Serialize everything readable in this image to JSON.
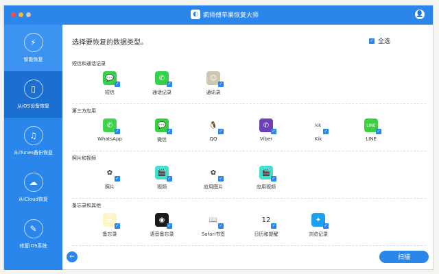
{
  "window": {
    "title": "疯师傅苹果恢复大师"
  },
  "sidebar": {
    "items": [
      {
        "label": "智能恢复",
        "icon": "smart-recovery-icon",
        "glyph": "⚡"
      },
      {
        "label": "从iOS设备恢复",
        "icon": "phone-icon",
        "glyph": "▯"
      },
      {
        "label": "从iTunes备份恢复",
        "icon": "music-icon",
        "glyph": "♫"
      },
      {
        "label": "从iCloud恢复",
        "icon": "cloud-icon",
        "glyph": "☁"
      },
      {
        "label": "修复iOS系统",
        "icon": "wrench-icon",
        "glyph": "✎"
      }
    ]
  },
  "main": {
    "heading": "选择要恢复的数据类型。",
    "select_all": "全选",
    "sections": [
      {
        "label": "短信和通话记录",
        "items": [
          {
            "label": "短信",
            "icon": "messages-icon",
            "color": "#35d14a",
            "glyph": "💬"
          },
          {
            "label": "通话记录",
            "icon": "phone-call-icon",
            "color": "#35d14a",
            "glyph": "✆"
          },
          {
            "label": "通讯录",
            "icon": "contacts-icon",
            "color": "#cfc6b0",
            "glyph": "☺"
          }
        ]
      },
      {
        "label": "第三方应用",
        "items": [
          {
            "label": "WhatsApp",
            "icon": "whatsapp-icon",
            "color": "#3dd44c",
            "glyph": "✆"
          },
          {
            "label": "微信",
            "icon": "wechat-icon",
            "color": "#34d03e",
            "glyph": "💬"
          },
          {
            "label": "QQ",
            "icon": "qq-icon",
            "color": "#ffffff",
            "glyph": "🐧"
          },
          {
            "label": "Viber",
            "icon": "viber-icon",
            "color": "#6a3fb8",
            "glyph": "✆"
          },
          {
            "label": "Kik",
            "icon": "kik-icon",
            "color": "#ffffff",
            "glyph": "kik"
          },
          {
            "label": "LINE",
            "icon": "line-icon",
            "color": "#38d33c",
            "glyph": "LINE"
          }
        ]
      },
      {
        "label": "照片和视频",
        "items": [
          {
            "label": "照片",
            "icon": "photos-icon",
            "color": "#ffffff",
            "glyph": "✿"
          },
          {
            "label": "视频",
            "icon": "video-icon",
            "color": "#3fe0d0",
            "glyph": "🎬"
          },
          {
            "label": "应用图片",
            "icon": "app-photos-icon",
            "color": "#ffffff",
            "glyph": "✿"
          },
          {
            "label": "应用视频",
            "icon": "app-video-icon",
            "color": "#3fe0d0",
            "glyph": "🎬"
          }
        ]
      },
      {
        "label": "备忘录和其他",
        "items": [
          {
            "label": "备忘录",
            "icon": "notes-icon",
            "color": "#fff6c8",
            "glyph": "☰"
          },
          {
            "label": "语音备忘录",
            "icon": "voice-memo-icon",
            "color": "#1a1a1a",
            "glyph": "◉"
          },
          {
            "label": "Safari书签",
            "icon": "bookmarks-icon",
            "color": "#ffffff",
            "glyph": "📖"
          },
          {
            "label": "日历和提醒",
            "icon": "calendar-icon",
            "color": "#ffffff",
            "glyph": "12"
          },
          {
            "label": "浏览记录",
            "icon": "safari-icon",
            "color": "#1ea0f0",
            "glyph": "✦"
          }
        ]
      }
    ]
  },
  "footer": {
    "scan": "扫描",
    "back_glyph": "←"
  }
}
